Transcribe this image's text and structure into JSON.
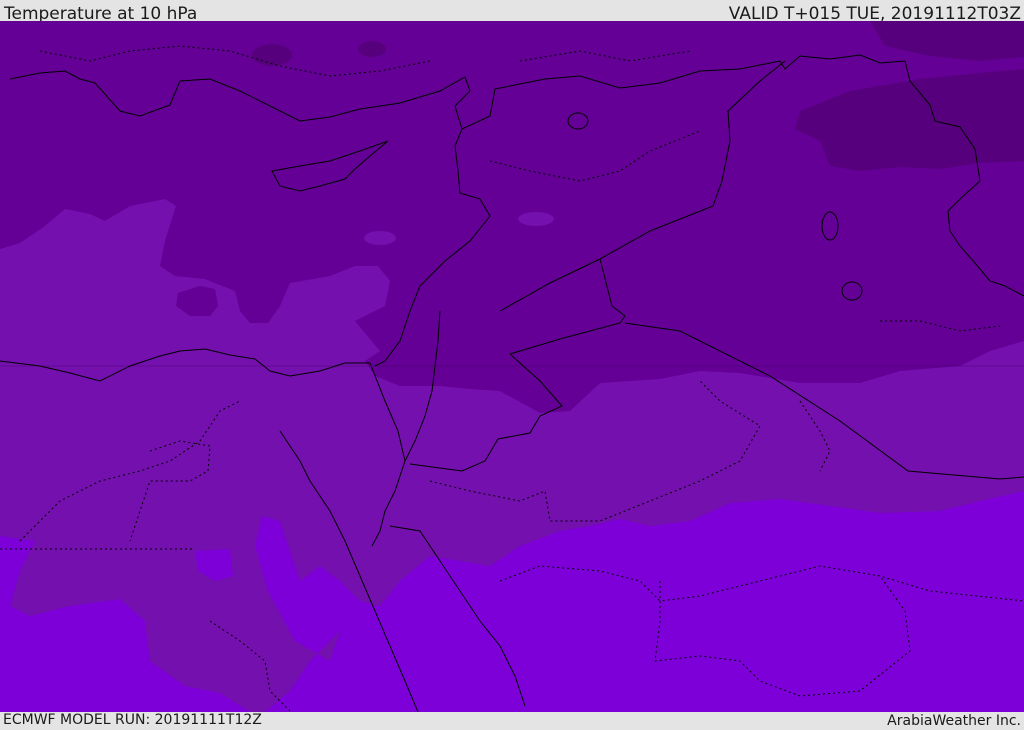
{
  "header": {
    "title": "Temperature at 10 hPa",
    "valid": "VALID T+015 TUE, 20191112T03Z"
  },
  "footer": {
    "model_run": "ECMWF MODEL RUN: 20191111T12Z",
    "credit": "ArabiaWeather Inc."
  },
  "colors": {
    "band_darkest": "#57007d",
    "band_dark": "#640096",
    "band_mid": "#7410ad",
    "band_light": "#7d00d9",
    "coastline": "#000000"
  }
}
